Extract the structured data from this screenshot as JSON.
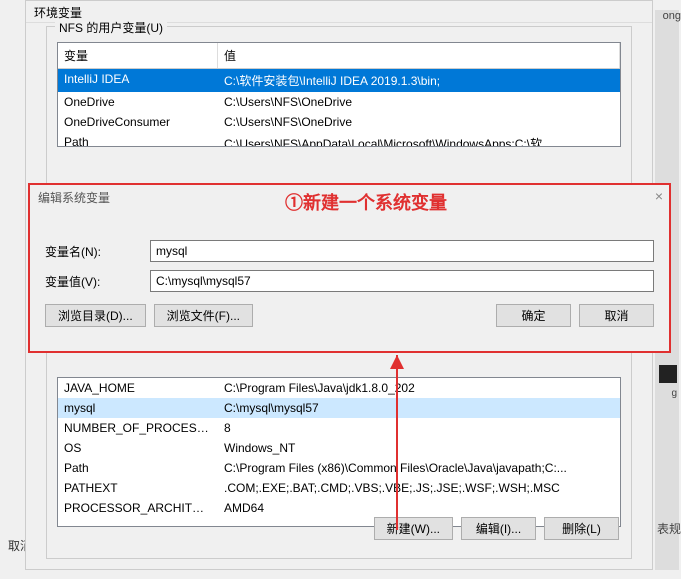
{
  "annotation": "①新建一个系统变量",
  "main_window": {
    "title": "环境变量",
    "user_section_label": "NFS 的用户变量(U)",
    "col_var": "变量",
    "col_val": "值"
  },
  "user_vars": [
    {
      "name": "IntelliJ IDEA",
      "value": "C:\\软件安装包\\IntelliJ IDEA 2019.1.3\\bin;"
    },
    {
      "name": "OneDrive",
      "value": "C:\\Users\\NFS\\OneDrive"
    },
    {
      "name": "OneDriveConsumer",
      "value": "C:\\Users\\NFS\\OneDrive"
    },
    {
      "name": "Path",
      "value": "C:\\Users\\NFS\\AppData\\Local\\Microsoft\\WindowsApps;C:\\软..."
    }
  ],
  "sys_vars": [
    {
      "name": "JAVA_HOME",
      "value": "C:\\Program Files\\Java\\jdk1.8.0_202"
    },
    {
      "name": "mysql",
      "value": "C:\\mysql\\mysql57"
    },
    {
      "name": "NUMBER_OF_PROCESSORS",
      "value": "8"
    },
    {
      "name": "OS",
      "value": "Windows_NT"
    },
    {
      "name": "Path",
      "value": "C:\\Program Files (x86)\\Common Files\\Oracle\\Java\\javapath;C:..."
    },
    {
      "name": "PATHEXT",
      "value": ".COM;.EXE;.BAT;.CMD;.VBS;.VBE;.JS;.JSE;.WSF;.WSH;.MSC"
    },
    {
      "name": "PROCESSOR_ARCHITECT...",
      "value": "AMD64"
    }
  ],
  "dialog": {
    "title": "编辑系统变量",
    "label_name": "变量名(N):",
    "label_value": "变量值(V):",
    "value_name": "mysql",
    "value_value": "C:\\mysql\\mysql57",
    "btn_browse_dir": "浏览目录(D)...",
    "btn_browse_file": "浏览文件(F)...",
    "btn_ok": "确定",
    "btn_cancel": "取消"
  },
  "buttons": {
    "new": "新建(W)...",
    "edit": "编辑(I)...",
    "delete": "删除(L)"
  },
  "bg": {
    "cancel": "取消",
    "ong": "ong",
    "g": "g",
    "expr": "表规"
  }
}
